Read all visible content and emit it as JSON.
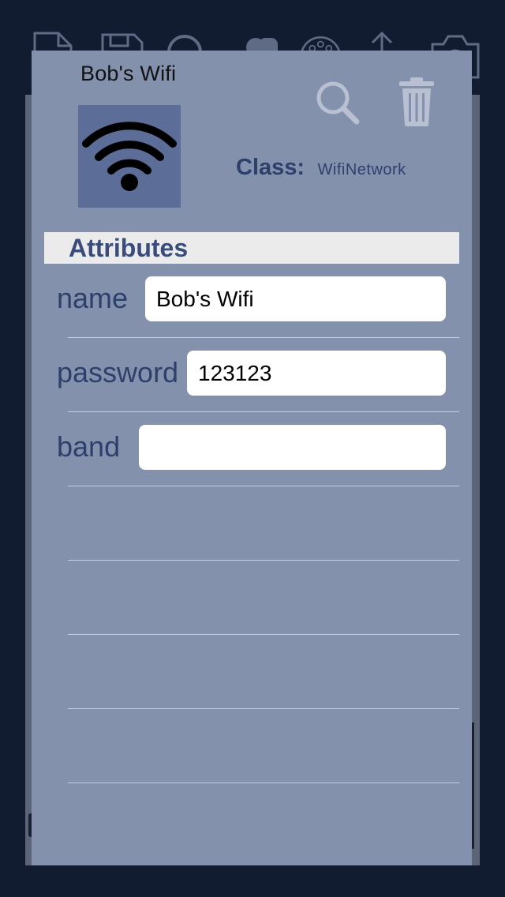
{
  "background_toolbar": {
    "icons": [
      "new-document-icon",
      "save-icon",
      "search-icon",
      "shapes-icon",
      "palette-icon",
      "share-icon",
      "camera-icon"
    ]
  },
  "object": {
    "title": "Bob's Wifi",
    "image_icon": "wifi-icon",
    "class_label": "Class:",
    "class_value": "WifiNetwork"
  },
  "actions": {
    "search_icon": "search-icon",
    "delete_icon": "trash-icon"
  },
  "attributes": {
    "header": "Attributes",
    "rows": [
      {
        "label": "name",
        "value": "Bob's Wifi"
      },
      {
        "label": "password",
        "value": "123123"
      },
      {
        "label": "band",
        "value": ""
      }
    ]
  },
  "colors": {
    "screen_background": "#121c30",
    "panel": "#8491ad",
    "accent_text": "#2d3f6b",
    "image_tile": "#5c6e97",
    "header_bar": "#ebebeb"
  }
}
